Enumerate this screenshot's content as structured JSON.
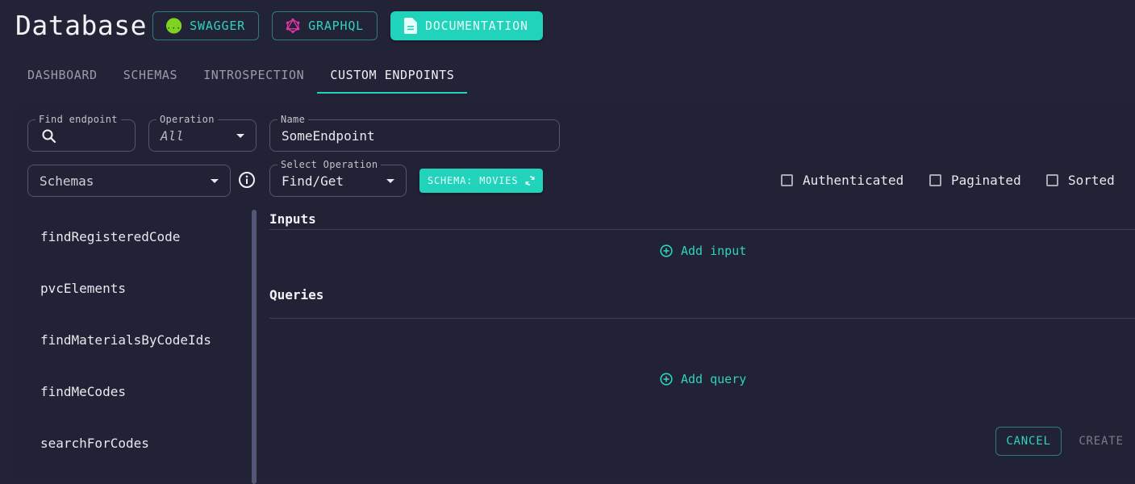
{
  "header": {
    "title": "Database",
    "buttons": {
      "swagger": "SWAGGER",
      "graphql": "GRAPHQL",
      "documentation": "DOCUMENTATION"
    }
  },
  "tabs": [
    {
      "label": "DASHBOARD",
      "active": false
    },
    {
      "label": "SCHEMAS",
      "active": false
    },
    {
      "label": "INTROSPECTION",
      "active": false
    },
    {
      "label": "CUSTOM ENDPOINTS",
      "active": true
    }
  ],
  "filters": {
    "find_endpoint": {
      "label": "Find endpoint",
      "value": ""
    },
    "operation": {
      "label": "Operation",
      "value": "All"
    },
    "schemas": {
      "value": "Schemas"
    }
  },
  "form": {
    "name": {
      "label": "Name",
      "value": "SomeEndpoint"
    },
    "select_operation": {
      "label": "Select Operation",
      "value": "Find/Get"
    },
    "schema_chip": "SCHEMA: MOVIES",
    "checkboxes": [
      {
        "label": "Authenticated",
        "checked": false
      },
      {
        "label": "Paginated",
        "checked": false
      },
      {
        "label": "Sorted",
        "checked": false
      }
    ],
    "inputs_title": "Inputs",
    "add_input": "Add input",
    "queries_title": "Queries",
    "add_query": "Add query",
    "cancel": "CANCEL",
    "create": "CREATE"
  },
  "endpoints": [
    "findRegisteredCode",
    "pvcElements",
    "findMaterialsByCodeIds",
    "findMeCodes",
    "searchForCodes"
  ],
  "colors": {
    "accent": "#22d3bc",
    "background": "#222337",
    "swagger_green": "#7ed321",
    "graphql_pink": "#e535ab"
  }
}
